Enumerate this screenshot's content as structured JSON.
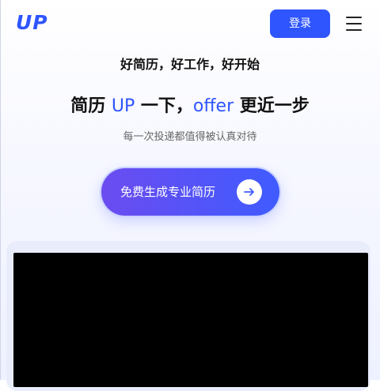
{
  "header": {
    "logo_text": "UP",
    "login_label": "登录",
    "menu_icon": "hamburger-menu-icon"
  },
  "hero": {
    "tagline": "好简历，好工作，好开始",
    "headline_part1": "简历 ",
    "headline_accent1": "UP",
    "headline_part2": " 一下，",
    "headline_accent2": "offer",
    "headline_part3": " 更近一步",
    "subtitle": "每一次投递都值得被认真对待",
    "cta_label": "免费生成专业简历",
    "cta_icon": "arrow-right-icon"
  },
  "colors": {
    "brand": "#2f55ff",
    "cta_gradient_start": "#6b4cf0",
    "cta_gradient_end": "#3f5bff",
    "video_background": "#000000"
  }
}
